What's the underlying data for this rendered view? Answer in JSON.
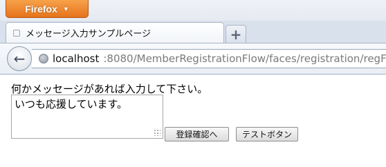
{
  "browser": {
    "menu_button": "Firefox",
    "menu_caret": "▼",
    "tab_title": "メッセージ入力サンプルページ",
    "new_tab_symbol": "+",
    "back_symbol": "←",
    "url_host": "localhost",
    "url_rest": ":8080/MemberRegistrationFlow/faces/registration/regFir"
  },
  "page": {
    "prompt": "何かメッセージがあれば入力して下さい。",
    "message_value": "いつも応援しています。",
    "confirm_button": "登録確認へ",
    "test_button": "テストボタン"
  }
}
